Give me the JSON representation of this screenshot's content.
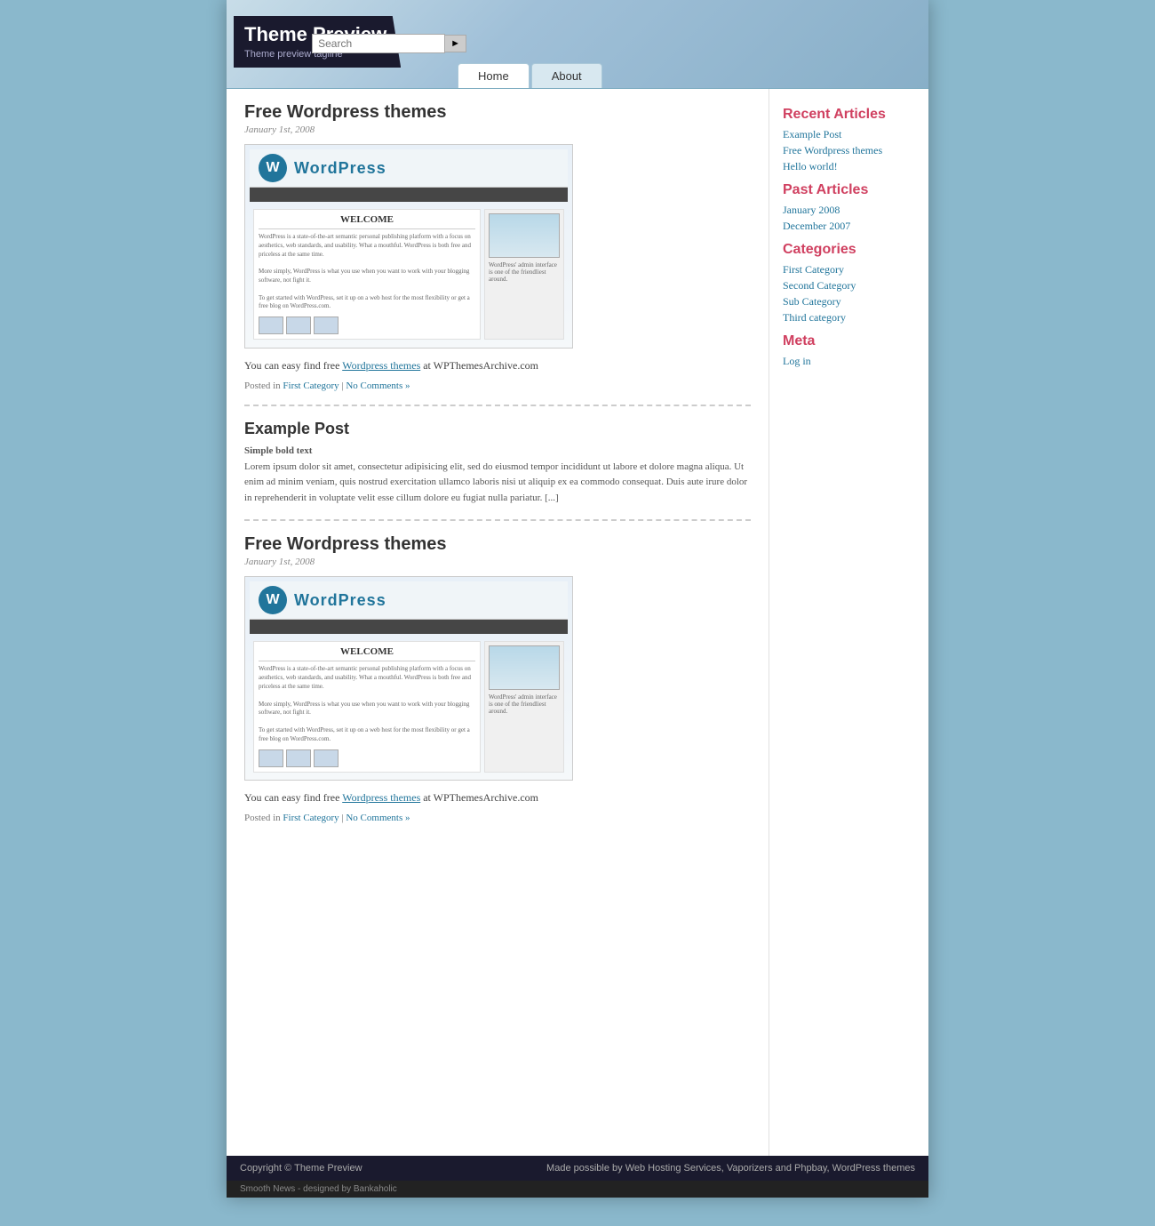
{
  "site": {
    "title": "Theme Preview",
    "tagline": "Theme preview tagline"
  },
  "nav": {
    "items": [
      {
        "label": "Home",
        "active": true
      },
      {
        "label": "About",
        "active": false
      }
    ]
  },
  "search": {
    "placeholder": "Search",
    "button_label": "🔍"
  },
  "sidebar": {
    "recent_articles_title": "Recent Articles",
    "recent_articles": [
      {
        "label": "Example Post"
      },
      {
        "label": "Free Wordpress themes"
      },
      {
        "label": "Hello world!"
      }
    ],
    "past_articles_title": "Past Articles",
    "past_articles": [
      {
        "label": "January 2008"
      },
      {
        "label": "December 2007"
      }
    ],
    "categories_title": "Categories",
    "categories": [
      {
        "label": "First Category"
      },
      {
        "label": "Second Category"
      },
      {
        "label": "Sub Category"
      },
      {
        "label": "Third category"
      }
    ],
    "meta_title": "Meta",
    "meta_items": [
      {
        "label": "Log in"
      }
    ]
  },
  "posts": [
    {
      "id": "post-1",
      "title": "Free Wordpress themes",
      "date": "January 1st, 2008",
      "text_before": "You can easy find free",
      "link_text": "Wordpress themes",
      "text_after": "at WPThemesArchive.com",
      "posted_in_label": "Posted in",
      "category": "First Category",
      "separator": "|",
      "comments": "No Comments »"
    },
    {
      "id": "post-2",
      "title": "Example Post",
      "bold_text": "Simple bold text",
      "body": "Lorem ipsum dolor sit amet, consectetur adipisicing elit, sed do eiusmod tempor incididunt ut labore et dolore magna aliqua. Ut enim ad minim veniam, quis nostrud exercitation ullamco laboris nisi ut aliquip ex ea commodo consequat. Duis aute irure dolor in reprehenderit in voluptate velit esse cillum dolore eu fugiat nulla pariatur. [...]"
    },
    {
      "id": "post-3",
      "title": "Free Wordpress themes",
      "date": "January 1st, 2008",
      "text_before": "You can easy find free",
      "link_text": "Wordpress themes",
      "text_after": "at WPThemesArchive.com",
      "posted_in_label": "Posted in",
      "category": "First Category",
      "separator": "|",
      "comments": "No Comments »"
    }
  ],
  "footer": {
    "copyright": "Copyright © Theme Preview",
    "made_possible": "Made possible by Web Hosting Services, Vaporizers and Phpbay, WordPress themes",
    "design_credit": "Smooth News - designed by Bankaholic"
  }
}
